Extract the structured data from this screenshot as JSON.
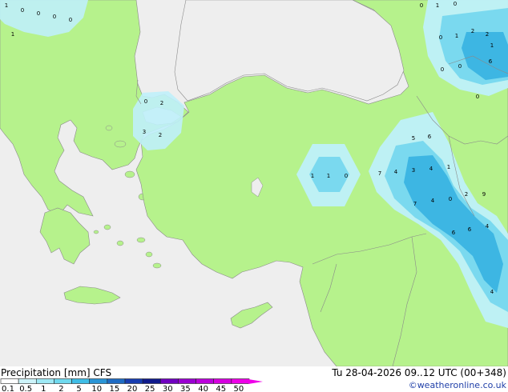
{
  "footer": {
    "title": "Precipitation [mm]  CFS",
    "datetime": "Tu 28-04-2026 09..12 UTC (00+348)",
    "credit": "©weatheronline.co.uk"
  },
  "legend": {
    "labels": [
      "0.1",
      "0.5",
      "1",
      "2",
      "5",
      "10",
      "15",
      "20",
      "25",
      "30",
      "35",
      "40",
      "45",
      "50"
    ],
    "colors": [
      "#ffffff",
      "#cdf4fa",
      "#9ee9f5",
      "#6fd9ee",
      "#3fbde6",
      "#2a95d6",
      "#1f6cc4",
      "#173db0",
      "#0f1a8c",
      "#7000c0",
      "#9a00d2",
      "#bb00dc",
      "#d600e0",
      "#ee00e8"
    ]
  },
  "colors": {
    "land": "#b6f28c",
    "sea": "#eeeeee",
    "precip_light": "#bff0fa",
    "precip_medium": "#7ad9ef",
    "precip_heavy": "#3db6e3"
  },
  "map_labels": [
    "1",
    "0",
    "0",
    "0",
    "0",
    "0",
    "1",
    "0",
    "1",
    "2",
    "1",
    "0",
    "2",
    "1",
    "6",
    "0",
    "0",
    "0",
    "0",
    "2",
    "3",
    "2",
    "1",
    "1",
    "0",
    "5",
    "6",
    "7",
    "4",
    "3",
    "4",
    "1",
    "2",
    "9",
    "7",
    "4",
    "0",
    "6",
    "6",
    "4",
    "4"
  ]
}
